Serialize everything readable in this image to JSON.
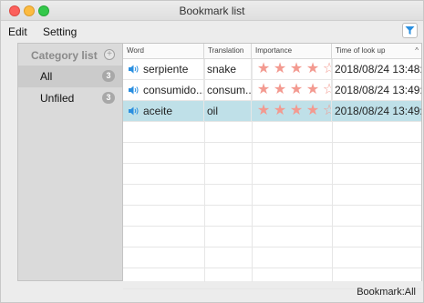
{
  "window": {
    "title": "Bookmark list"
  },
  "menu": {
    "edit": "Edit",
    "setting": "Setting"
  },
  "sidebar": {
    "title": "Category list",
    "categories": [
      {
        "label": "All",
        "count": "3",
        "selected": true
      },
      {
        "label": "Unfiled",
        "count": "3",
        "selected": false
      }
    ]
  },
  "table": {
    "headers": {
      "word": "Word",
      "translation": "Translation",
      "importance": "Importance",
      "time": "Time of look up"
    },
    "rows": [
      {
        "word": "serpiente",
        "translation": "snake",
        "importance": 4,
        "time": "2018/08/24 13:48:...",
        "selected": false
      },
      {
        "word": "consumido...",
        "translation": "consum...",
        "importance": 4,
        "time": "2018/08/24 13:49:...",
        "selected": false
      },
      {
        "word": "aceite",
        "translation": "oil",
        "importance": 4,
        "time": "2018/08/24 13:49:...",
        "selected": true
      }
    ],
    "max_importance": 5
  },
  "status": {
    "text": "Bookmark:All"
  },
  "colors": {
    "selected_row": "#bfe0e8",
    "star": "#f39a90",
    "filter_icon": "#2a8fe0"
  }
}
